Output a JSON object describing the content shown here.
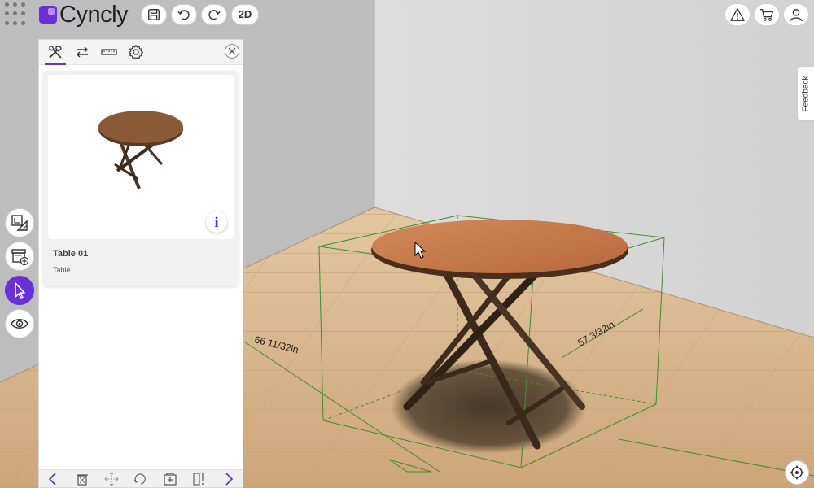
{
  "app": {
    "logo_text": "Cyncly"
  },
  "toolbar": {
    "view_toggle_label": "2D"
  },
  "feedback": {
    "label": "Feedback"
  },
  "product": {
    "name": "Table 01",
    "category": "Table",
    "info_glyph": "i"
  },
  "scene": {
    "dimension_width": "66 11/32in",
    "dimension_depth": "57 3/32in"
  },
  "colors": {
    "accent": "#6a2fd6",
    "selection_box": "#3f8f2f",
    "wall": "#d9d9d9",
    "floor": "#d8b88e"
  }
}
